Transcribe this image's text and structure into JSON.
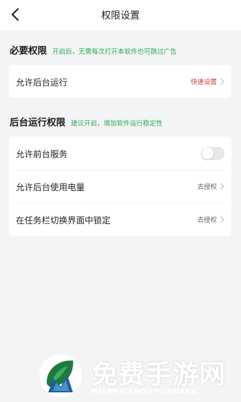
{
  "navbar": {
    "title": "权限设置"
  },
  "sections": [
    {
      "title": "必要权限",
      "hint": "开启后，无需每次打开本软件也可跳过广告",
      "items": [
        {
          "label": "允许后台运行",
          "action": "快速设置"
        }
      ]
    },
    {
      "title": "后台运行权限",
      "hint": "建议开启，增加软件运行稳定性",
      "items": [
        {
          "label": "允许前台服务",
          "toggle": "off"
        },
        {
          "label": "允许后台使用电量",
          "action": "去授权"
        },
        {
          "label": "在任务栏切换界面中锁定",
          "action": "去授权"
        }
      ]
    }
  ],
  "watermark": {
    "title": "免费手游网",
    "subtitle": "MIANFEISHOUYOUWANG"
  },
  "colors": {
    "accent_green": "#2daa52",
    "action_red": "#d23c3c",
    "background": "#f3f4f6"
  },
  "icons": {
    "back": "chevron-left-icon",
    "row_arrow": "chevron-right-icon",
    "logo": "leaf-m-logo"
  }
}
